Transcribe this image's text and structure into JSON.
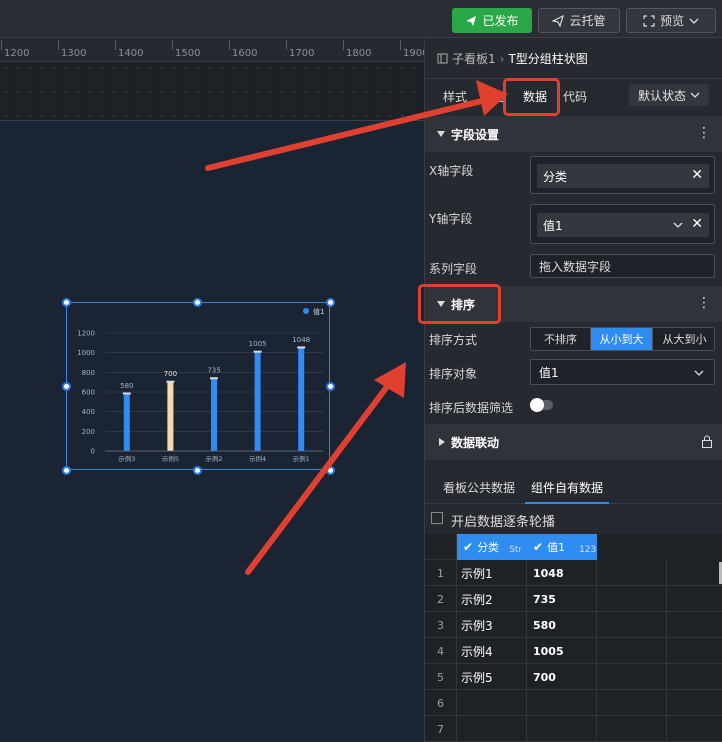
{
  "topbar": {
    "publish_label": "已发布",
    "cloud_label": "云托管",
    "preview_label": "预览"
  },
  "ruler": {
    "ticks": [
      "1200",
      "1300",
      "1400",
      "1500",
      "1600",
      "1700",
      "1800",
      "1900"
    ]
  },
  "panel": {
    "breadcrumb_parent": "子看板1",
    "breadcrumb_current": "T型分组柱状图",
    "tabs": [
      "样式",
      "交互",
      "数据",
      "代码"
    ],
    "state_select": "默认状态",
    "field_settings": {
      "title": "字段设置",
      "x_label": "X轴字段",
      "x_value": "分类",
      "y_label": "Y轴字段",
      "y_value": "值1",
      "series_label": "系列字段",
      "series_placeholder": "拖入数据字段"
    },
    "sort": {
      "title": "排序",
      "method_label": "排序方式",
      "options": [
        "不排序",
        "从小到大",
        "从大到小"
      ],
      "active_option": "从小到大",
      "target_label": "排序对象",
      "target_value": "值1",
      "filter_label": "排序后数据筛选"
    },
    "linkage": {
      "title": "数据联动"
    },
    "data_tabs": [
      "看板公共数据",
      "组件自有数据"
    ],
    "carousel_label": "开启数据逐条轮播",
    "grid": {
      "col1_name": "分类",
      "col1_type": "Str",
      "col2_name": "值1",
      "col2_type": "123",
      "rows": [
        {
          "idx": "1",
          "cat": "示例1",
          "val": "1048"
        },
        {
          "idx": "2",
          "cat": "示例2",
          "val": "735"
        },
        {
          "idx": "3",
          "cat": "示例3",
          "val": "580"
        },
        {
          "idx": "4",
          "cat": "示例4",
          "val": "1005"
        },
        {
          "idx": "5",
          "cat": "示例5",
          "val": "700"
        },
        {
          "idx": "6",
          "cat": "",
          "val": ""
        },
        {
          "idx": "7",
          "cat": "",
          "val": ""
        }
      ]
    }
  },
  "chart_data": {
    "type": "bar",
    "legend": "值1",
    "categories": [
      "示例3",
      "示例5",
      "示例2",
      "示例4",
      "示例1"
    ],
    "values": [
      580,
      700,
      735,
      1005,
      1048
    ],
    "value_labels": [
      "580",
      "700",
      "735",
      "1005",
      "1048"
    ],
    "highlight_index": 1,
    "yticks": [
      "0",
      "200",
      "400",
      "600",
      "800",
      "1000",
      "1200"
    ],
    "ylim": [
      0,
      1200
    ],
    "bar_color": "#2f8cf0",
    "highlight_color": "#f6d9b0"
  },
  "colors": {
    "accent": "#2f8cf0",
    "publish": "#2aa847",
    "annotation": "#e0402f"
  }
}
